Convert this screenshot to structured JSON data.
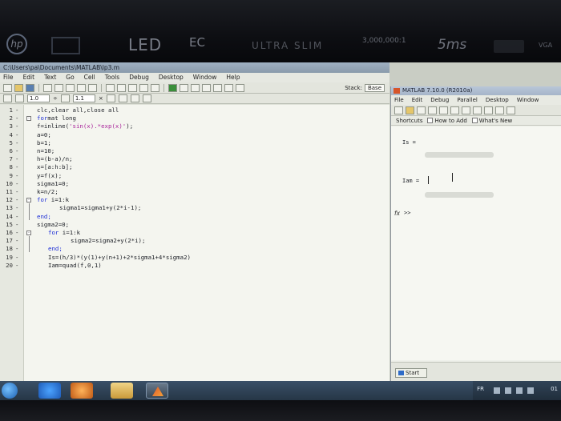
{
  "bezel": {
    "brand_hp": "hp",
    "brand_led": "LED",
    "brand_eco": "EC",
    "brand_ultra": "ULTRA SLIM",
    "brand_ratio": "3,000,000:1",
    "brand_ms": "5ms",
    "brand_vga": "VGA"
  },
  "editor": {
    "title": "C:\\Users\\pa\\Documents\\MATLAB\\lp3.m",
    "menu": [
      "File",
      "Edit",
      "Text",
      "Go",
      "Cell",
      "Tools",
      "Debug",
      "Desktop",
      "Window",
      "Help"
    ],
    "stack_label": "Stack:",
    "stack_value": "Base",
    "cell_value1": "1.0",
    "cell_value2": "1.1",
    "cell_divide": "÷",
    "cell_times": "×",
    "lines": [
      {
        "n": "1",
        "code": "clc,clear all,close all",
        "indent": 0
      },
      {
        "n": "2",
        "code": "format long",
        "indent": 0
      },
      {
        "n": "3",
        "code": "f=inline('sin(x).*exp(x)');",
        "indent": 0
      },
      {
        "n": "4",
        "code": "a=0;",
        "indent": 0
      },
      {
        "n": "5",
        "code": "b=1;",
        "indent": 0
      },
      {
        "n": "6",
        "code": "n=10;",
        "indent": 0
      },
      {
        "n": "7",
        "code": "h=(b-a)/n;",
        "indent": 0
      },
      {
        "n": "8",
        "code": "x=[a:h:b];",
        "indent": 0
      },
      {
        "n": "9",
        "code": "y=f(x);",
        "indent": 0
      },
      {
        "n": "10",
        "code": "sigma1=0;",
        "indent": 0
      },
      {
        "n": "11",
        "code": "k=n/2;",
        "indent": 0
      },
      {
        "n": "12",
        "code": "for i=1:k",
        "indent": 0
      },
      {
        "n": "13",
        "code": "sigma1=sigma1+y(2*i-1);",
        "indent": 2
      },
      {
        "n": "14",
        "code": "end;",
        "indent": 0
      },
      {
        "n": "15",
        "code": "sigma2=0;",
        "indent": 0
      },
      {
        "n": "16",
        "code": "for i=1:k",
        "indent": 1
      },
      {
        "n": "17",
        "code": "sigma2=sigma2+y(2*i);",
        "indent": 3
      },
      {
        "n": "18",
        "code": "end;",
        "indent": 1
      },
      {
        "n": "19",
        "code": "Is=(h/3)*(y(1)+y(n+1)+2*sigma1+4*sigma2)",
        "indent": 1
      },
      {
        "n": "20",
        "code": "Iam=quad(f,0,1)",
        "indent": 1
      }
    ]
  },
  "command": {
    "title": "MATLAB 7.10.0 (R2010a)",
    "menu": [
      "File",
      "Edit",
      "Debug",
      "Parallel",
      "Desktop",
      "Window"
    ],
    "shortcuts": "Shortcuts",
    "how_to_add": "How to Add",
    "whats_new": "What's New",
    "out_is": "Is =",
    "out_iam": "Iam =",
    "prompt": ">>",
    "fx": "fx",
    "start": "Start"
  },
  "taskbar": {
    "lang": "FR",
    "clock": "01"
  }
}
